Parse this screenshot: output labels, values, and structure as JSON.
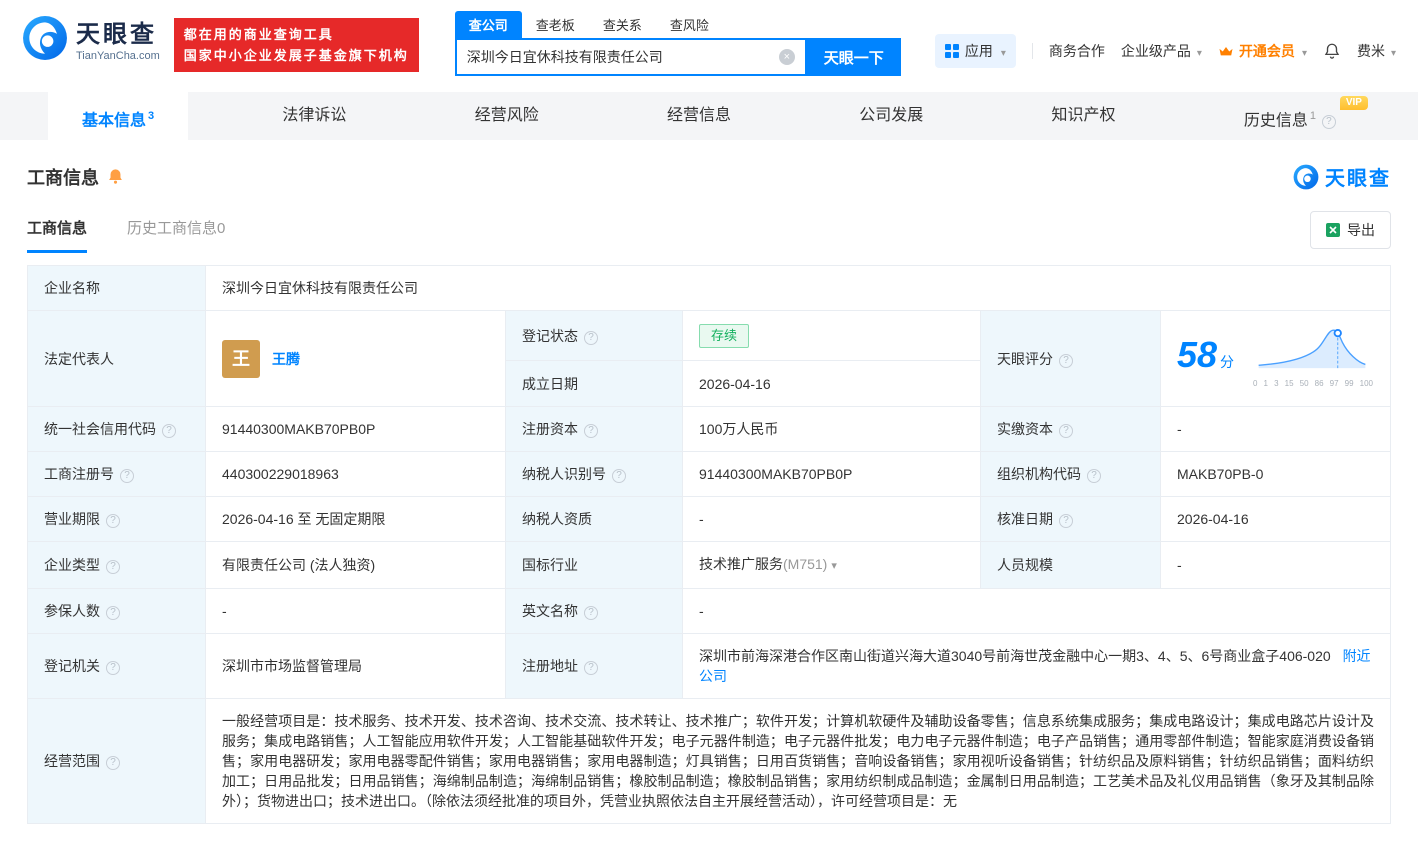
{
  "brand": {
    "name": "天眼查",
    "domain": "TianYanCha.com",
    "slogan_line1": "都在用的商业查询工具",
    "slogan_line2": "国家中小企业发展子基金旗下机构",
    "colors": {
      "blue": "#0084ff",
      "red": "#e62929",
      "orange": "#ff8000",
      "green": "#12b05d"
    }
  },
  "header": {
    "search_tabs": [
      {
        "label": "查公司",
        "active": true
      },
      {
        "label": "查老板",
        "active": false
      },
      {
        "label": "查关系",
        "active": false
      },
      {
        "label": "查风险",
        "active": false
      }
    ],
    "search_value": "深圳今日宜休科技有限责任公司",
    "search_button": "天眼一下",
    "menu": {
      "apps": "应用",
      "cooperation": "商务合作",
      "enterprise_product": "企业级产品",
      "vip": "开通会员",
      "username": "费米"
    }
  },
  "nav": {
    "vip_tag": "VIP",
    "tabs": [
      {
        "label": "基本信息",
        "sup": "3",
        "active": true,
        "vip": false,
        "help": false
      },
      {
        "label": "法律诉讼",
        "sup": "",
        "active": false,
        "vip": false,
        "help": false
      },
      {
        "label": "经营风险",
        "sup": "",
        "active": false,
        "vip": false,
        "help": false
      },
      {
        "label": "经营信息",
        "sup": "",
        "active": false,
        "vip": false,
        "help": false
      },
      {
        "label": "公司发展",
        "sup": "",
        "active": false,
        "vip": false,
        "help": false
      },
      {
        "label": "知识产权",
        "sup": "",
        "active": false,
        "vip": false,
        "help": false
      },
      {
        "label": "历史信息",
        "sup": "1",
        "active": false,
        "vip": true,
        "help": true
      }
    ]
  },
  "section": {
    "title": "工商信息",
    "tab_current": "工商信息",
    "tab_history": "历史工商信息0",
    "export_label": "导出"
  },
  "company": {
    "name_label": "企业名称",
    "name": "深圳今日宜休科技有限责任公司",
    "legal_rep_label": "法定代表人",
    "legal_rep_avatar": "王",
    "legal_rep": "王腾",
    "reg_status_label": "登记状态",
    "reg_status": "存续",
    "establish_label": "成立日期",
    "establish_date": "2026-04-16",
    "score_label": "天眼评分",
    "score": "58",
    "score_unit": "分",
    "credit_code_label": "统一社会信用代码",
    "credit_code": "91440300MAKB70PB0P",
    "reg_capital_label": "注册资本",
    "reg_capital": "100万人民币",
    "paid_capital_label": "实缴资本",
    "paid_capital": "-",
    "reg_number_label": "工商注册号",
    "reg_number": "440300229018963",
    "taxpayer_id_label": "纳税人识别号",
    "taxpayer_id": "91440300MAKB70PB0P",
    "org_code_label": "组织机构代码",
    "org_code": "MAKB70PB-0",
    "business_term_label": "营业期限",
    "business_term": "2026-04-16 至 无固定期限",
    "taxpayer_quality_label": "纳税人资质",
    "taxpayer_quality": "-",
    "approval_date_label": "核准日期",
    "approval_date": "2026-04-16",
    "company_type_label": "企业类型",
    "company_type": "有限责任公司 (法人独资)",
    "industry_label": "国标行业",
    "industry": "技术推广服务",
    "industry_code": "(M751)",
    "staff_size_label": "人员规模",
    "staff_size": "-",
    "insured_label": "参保人数",
    "insured": "-",
    "english_name_label": "英文名称",
    "english_name": "-",
    "reg_authority_label": "登记机关",
    "reg_authority": "深圳市市场监督管理局",
    "address_label": "注册地址",
    "address": "深圳市前海深港合作区南山街道兴海大道3040号前海世茂金融中心一期3、4、5、6号商业盒子406-020",
    "nearby_link": "附近公司",
    "scope_label": "经营范围",
    "scope": "一般经营项目是：技术服务、技术开发、技术咨询、技术交流、技术转让、技术推广；软件开发；计算机软硬件及辅助设备零售；信息系统集成服务；集成电路设计；集成电路芯片设计及服务；集成电路销售；人工智能应用软件开发；人工智能基础软件开发；电子元器件制造；电子元器件批发；电力电子元器件制造；电子产品销售；通用零部件制造；智能家庭消费设备销售；家用电器研发；家用电器零配件销售；家用电器销售；家用电器制造；灯具销售；日用百货销售；音响设备销售；家用视听设备销售；针纺织品及原料销售；针纺织品销售；面料纺织加工；日用品批发；日用品销售；海绵制品制造；海绵制品销售；橡胶制品制造；橡胶制品销售；家用纺织制成品制造；金属制日用品制造；工艺美术品及礼仪用品销售（象牙及其制品除外）；货物进出口；技术进出口。（除依法须经批准的项目外，凭营业执照依法自主开展经营活动），许可经营项目是：无"
  },
  "chart_data": {
    "type": "area",
    "title": "天眼评分",
    "score": 58,
    "score_unit": "分",
    "x_ticks": [
      "0",
      "1",
      "3",
      "15",
      "50",
      "86",
      "97",
      "99",
      "100"
    ],
    "curve_values_estimated": [
      2,
      3,
      6,
      12,
      30,
      58,
      42,
      16,
      5
    ],
    "marker_near_tick": "86",
    "legend": "none",
    "grid": false
  }
}
